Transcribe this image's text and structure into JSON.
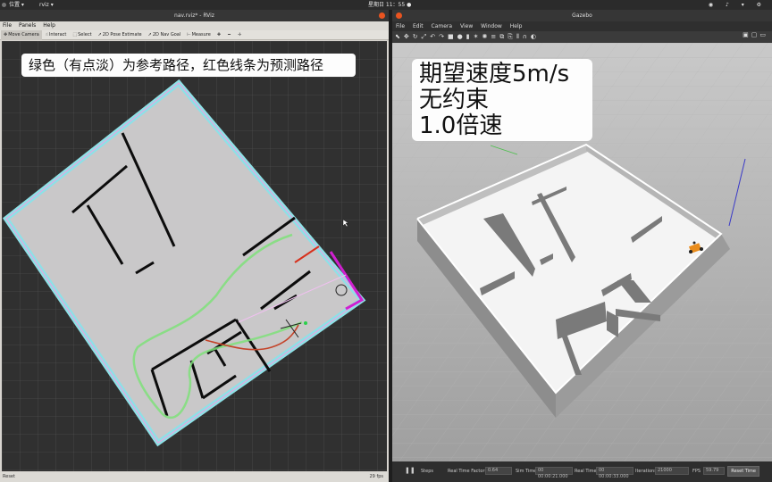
{
  "system_bar": {
    "app_menu": "位置 ▾",
    "app_name": "rviz ▾",
    "clock": "星期日 11：55 ●",
    "tray": "◉ ♪ ▾ ⚙"
  },
  "rviz": {
    "title": "nav.rviz* - RViz",
    "menu": [
      "File",
      "Panels",
      "Help"
    ],
    "toolbar": [
      {
        "label": "Move Camera",
        "icon": "move-camera-icon",
        "glyph": "✥",
        "active": true
      },
      {
        "label": "Interact",
        "icon": "interact-icon",
        "glyph": "☝",
        "active": false
      },
      {
        "label": "Select",
        "icon": "select-icon",
        "glyph": "⬚",
        "active": false
      },
      {
        "label": "2D Pose Estimate",
        "icon": "pose-estimate-icon",
        "glyph": "➚",
        "active": false
      },
      {
        "label": "2D Nav Goal",
        "icon": "nav-goal-icon",
        "glyph": "➚",
        "active": false
      },
      {
        "label": "Measure",
        "icon": "measure-icon",
        "glyph": "⊢",
        "active": false
      },
      {
        "label": "",
        "icon": "add-tool-icon",
        "glyph": "✚",
        "active": false
      },
      {
        "label": "",
        "icon": "remove-tool-icon",
        "glyph": "━",
        "active": false
      },
      {
        "label": "",
        "icon": "target-icon",
        "glyph": "✛",
        "active": false
      }
    ],
    "caption": "绿色（有点淡）为参考路径，红色线条为预测路径",
    "status": {
      "reset": "Reset",
      "fps": "29 fps"
    }
  },
  "gazebo": {
    "title": "Gazebo",
    "menu": [
      "File",
      "Edit",
      "Camera",
      "View",
      "Window",
      "Help"
    ],
    "toolbar_icons": [
      "pointer-icon",
      "translate-icon",
      "rotate-icon",
      "scale-icon",
      "undo-icon",
      "redo-icon",
      "box-icon",
      "sphere-icon",
      "cylinder-icon",
      "light-icon",
      "spotlight-icon",
      "dirlight-icon",
      "copy-icon",
      "paste-icon",
      "align-icon",
      "snap-icon",
      "camera-view-icon"
    ],
    "toolbar_glyphs": [
      "⬉",
      "✥",
      "↻",
      "⤢",
      "↶",
      "↷",
      "■",
      "●",
      "▮",
      "✶",
      "✺",
      "≡",
      "⧉",
      "⎘",
      "⫴",
      "∩",
      "◐"
    ],
    "right_icons": [
      "▣",
      "▢",
      "▭"
    ],
    "caption": [
      "期望速度5m/s",
      "无约束",
      "1.0倍速"
    ],
    "bottom": {
      "pause": "❚❚",
      "steps_label": "Steps",
      "rt_label": "Real Time Factor:",
      "rt_value": "0.64",
      "sim_label": "Sim Time",
      "sim_value": "00 00:00:21.000",
      "real_label": "Real Time",
      "real_value": "00 00:00:33.000",
      "iter_label": "Iterations",
      "iter_value": "21000",
      "fps_label": "FPS",
      "fps_value": "59.79",
      "reset": "Reset Time"
    }
  }
}
